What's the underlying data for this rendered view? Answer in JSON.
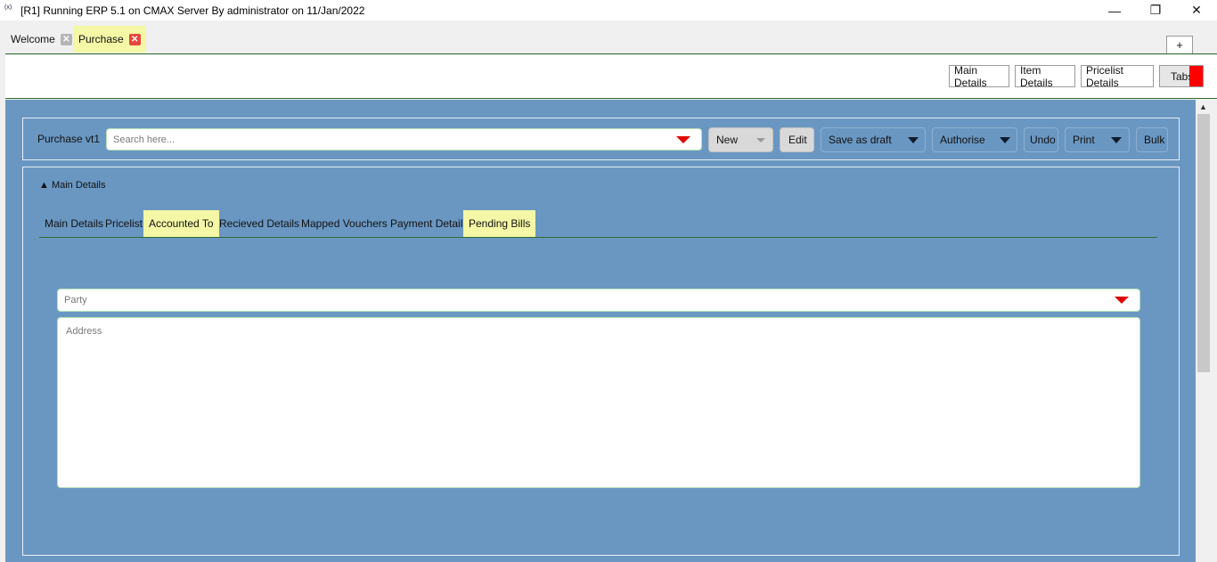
{
  "window": {
    "title": "[R1] Running ERP 5.1 on CMAX Server By administrator on 11/Jan/2022",
    "minimize": "—",
    "maximize": "❐",
    "close": "✕"
  },
  "tabs": [
    {
      "label": "Welcome",
      "close": "✕"
    },
    {
      "label": "Purchase",
      "close": "✕"
    }
  ],
  "add_tab": "+",
  "topbar": {
    "main_details": "Main Details",
    "item_details": "Item Details",
    "pricelist_details": "Pricelist Details",
    "tabs": "Tabs"
  },
  "toolbar": {
    "label": "Purchase vt1",
    "search_placeholder": "Search here...",
    "new": "New",
    "edit": "Edit",
    "save_as_draft": "Save as draft",
    "authorise": "Authorise",
    "undo": "Undo",
    "print": "Print",
    "bulk": "Bulk"
  },
  "section": {
    "toggle": "▲ Main Details",
    "subtabs": [
      "Main Details",
      "Pricelist",
      "Accounted To",
      "Recieved Details",
      "Mapped Vouchers",
      "Payment Details",
      "Pending Bills"
    ]
  },
  "form": {
    "party_placeholder": "Party",
    "address_placeholder": "Address"
  },
  "scroll": {
    "up": "▲"
  },
  "colors": {
    "accent_yellow": "#f4f7a5",
    "main_blue": "#6a97c2",
    "dropdown_red": "#e00000",
    "divider_green": "#2f6b2f"
  }
}
